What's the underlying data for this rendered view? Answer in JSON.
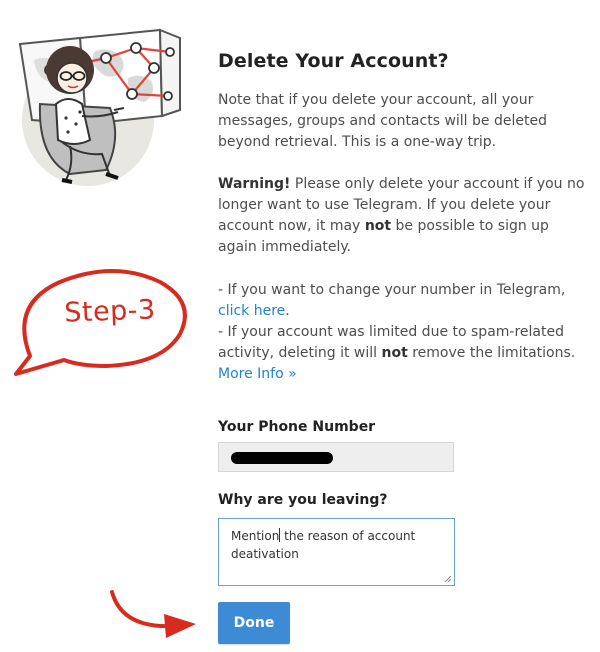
{
  "title": "Delete Your Account?",
  "intro": "Note that if you delete your account, all your messages, groups and contacts will be deleted beyond retrieval. This is a one-way trip.",
  "warning": {
    "label": "Warning!",
    "text_before_not": "Please only delete your account if you no longer want to use Telegram. If you delete your account now, it may",
    "not": "not",
    "text_after_not": "be possible to sign up again immediately."
  },
  "notes": {
    "change_number": "- If you want to change your number in Telegram,",
    "click_here": "click here",
    "limited_before_not": "- If your account was limited due to spam-related activity, deleting it will",
    "not": "not",
    "limited_after_not": "remove the limitations.",
    "more_info": "More Info »"
  },
  "form": {
    "phone_label": "Your Phone Number",
    "reason_label": "Why are you leaving?",
    "reason_value_before_caret": "Mention",
    "reason_value_after_caret": " the reason of account deativation",
    "done_label": "Done"
  },
  "annotation": {
    "step_label": "Step-3",
    "color": "#d62b1e"
  },
  "colors": {
    "link": "#2481cc",
    "button": "#3d8bd5",
    "focus_border": "#6aa2d8"
  }
}
